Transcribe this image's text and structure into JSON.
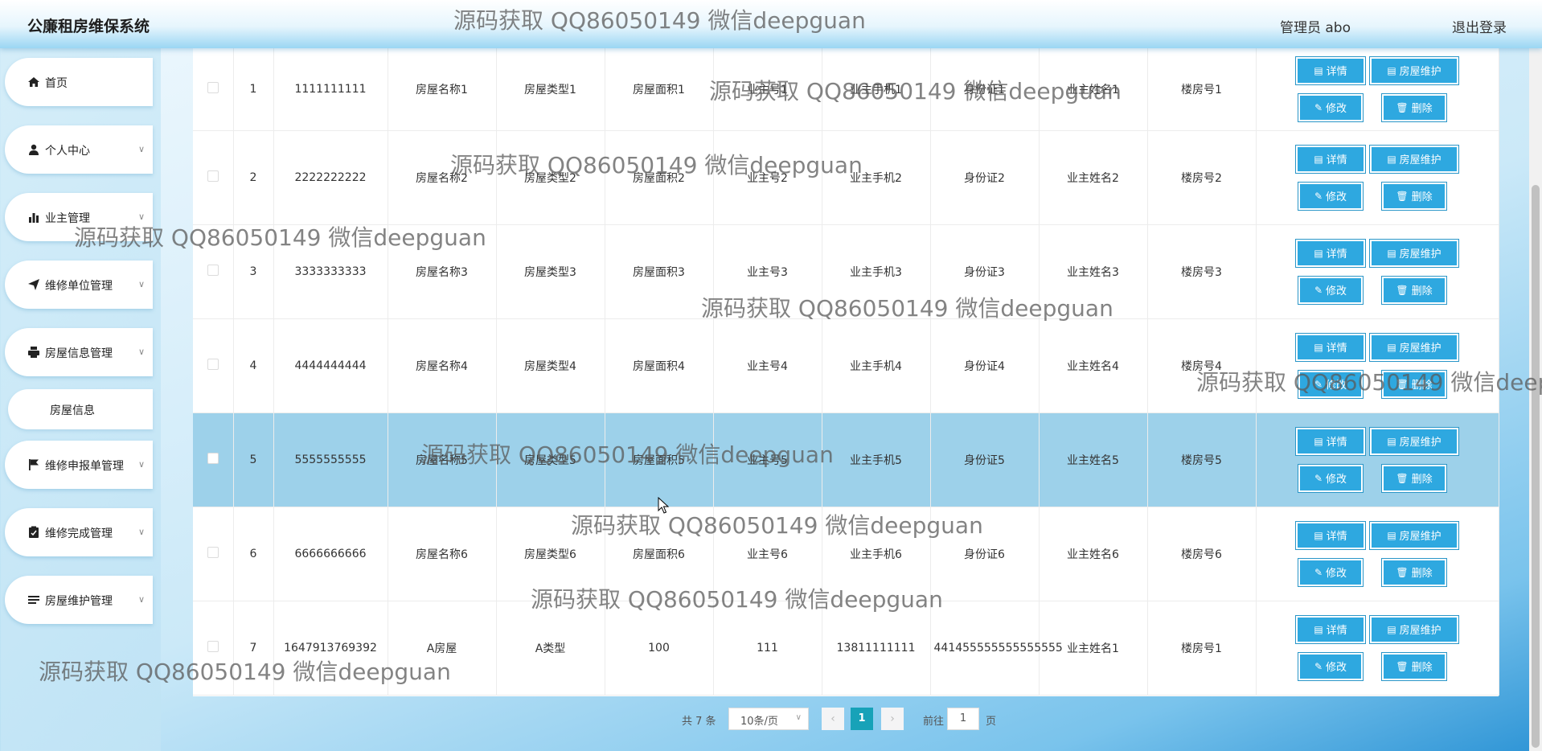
{
  "header": {
    "title": "公廉租房维保系统",
    "user": "管理员 abo",
    "logout": "退出登录"
  },
  "sidebar": {
    "items": [
      {
        "label": "首页",
        "icon": "home-icon",
        "has_chevron": false
      },
      {
        "label": "个人中心",
        "icon": "user-icon",
        "has_chevron": true
      },
      {
        "label": "业主管理",
        "icon": "bar-chart-icon",
        "has_chevron": true
      },
      {
        "label": "维修单位管理",
        "icon": "send-icon",
        "has_chevron": true
      },
      {
        "label": "房屋信息管理",
        "icon": "printer-icon",
        "has_chevron": true
      },
      {
        "label": "维修申报单管理",
        "icon": "flag-icon",
        "has_chevron": true
      },
      {
        "label": "维修完成管理",
        "icon": "clipboard-icon",
        "has_chevron": true
      },
      {
        "label": "房屋维护管理",
        "icon": "list-icon",
        "has_chevron": true
      }
    ],
    "submenu": {
      "label": "房屋信息"
    }
  },
  "buttons": {
    "detail": "详情",
    "maintain": "房屋维护",
    "edit": "修改",
    "delete": "删除"
  },
  "table": {
    "rows": [
      {
        "idx": "1",
        "code": "1111111111",
        "name": "房屋名称1",
        "type": "房屋类型1",
        "area": "房屋面积1",
        "owner_no": "业主号1",
        "phone": "业主手机1",
        "id_card": "身份证1",
        "owner_name": "业主姓名1",
        "building": "楼房号1"
      },
      {
        "idx": "2",
        "code": "2222222222",
        "name": "房屋名称2",
        "type": "房屋类型2",
        "area": "房屋面积2",
        "owner_no": "业主号2",
        "phone": "业主手机2",
        "id_card": "身份证2",
        "owner_name": "业主姓名2",
        "building": "楼房号2"
      },
      {
        "idx": "3",
        "code": "3333333333",
        "name": "房屋名称3",
        "type": "房屋类型3",
        "area": "房屋面积3",
        "owner_no": "业主号3",
        "phone": "业主手机3",
        "id_card": "身份证3",
        "owner_name": "业主姓名3",
        "building": "楼房号3"
      },
      {
        "idx": "4",
        "code": "4444444444",
        "name": "房屋名称4",
        "type": "房屋类型4",
        "area": "房屋面积4",
        "owner_no": "业主号4",
        "phone": "业主手机4",
        "id_card": "身份证4",
        "owner_name": "业主姓名4",
        "building": "楼房号4"
      },
      {
        "idx": "5",
        "code": "5555555555",
        "name": "房屋名称5",
        "type": "房屋类型5",
        "area": "房屋面积5",
        "owner_no": "业主号5",
        "phone": "业主手机5",
        "id_card": "身份证5",
        "owner_name": "业主姓名5",
        "building": "楼房号5"
      },
      {
        "idx": "6",
        "code": "6666666666",
        "name": "房屋名称6",
        "type": "房屋类型6",
        "area": "房屋面积6",
        "owner_no": "业主号6",
        "phone": "业主手机6",
        "id_card": "身份证6",
        "owner_name": "业主姓名6",
        "building": "楼房号6"
      },
      {
        "idx": "7",
        "code": "1647913769392",
        "name": "A房屋",
        "type": "A类型",
        "area": "100",
        "owner_no": "111",
        "phone": "13811111111",
        "id_card": "441455555555555555",
        "owner_name": "业主姓名1",
        "building": "楼房号1"
      }
    ]
  },
  "pagination": {
    "total": "共 7 条",
    "page_size": "10条/页",
    "current_page": "1",
    "goto": "前往",
    "goto_value": "1",
    "page_unit": "页"
  },
  "watermark": "源码获取 QQ86050149 微信deepguan",
  "colors": {
    "accent": "#2ea8e0",
    "highlight_row": "#9dd1ea",
    "active_page": "#17a2b8"
  }
}
